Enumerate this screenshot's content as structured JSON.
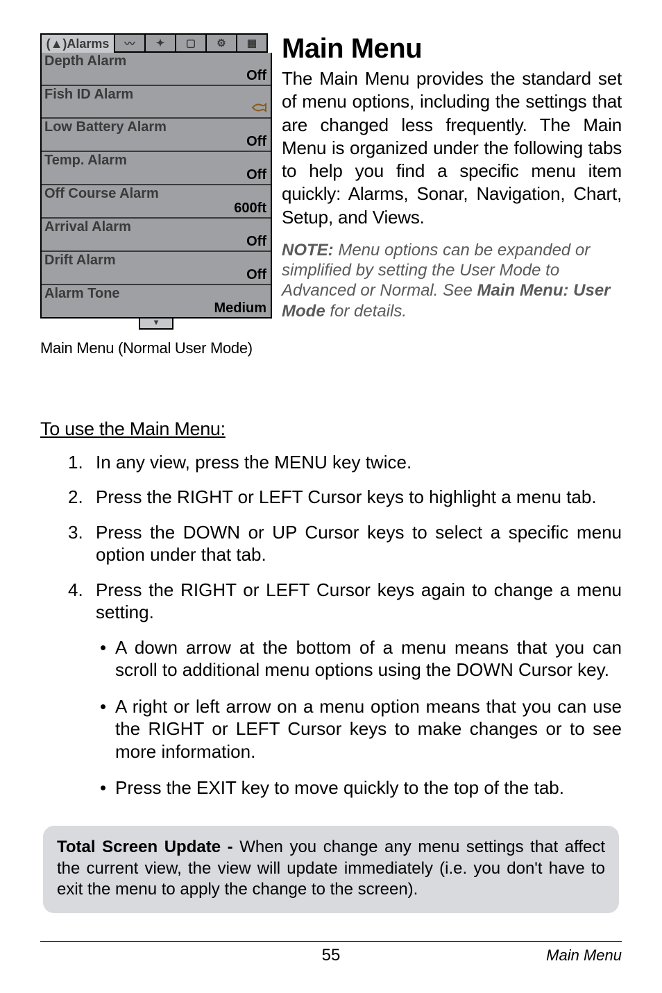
{
  "tabstrip": {
    "active_label": "(▲)Alarms"
  },
  "menu": {
    "rows": [
      {
        "label": "Depth Alarm",
        "value": "Off"
      },
      {
        "label": "Fish ID Alarm",
        "value": ""
      },
      {
        "label": "Low Battery Alarm",
        "value": "Off"
      },
      {
        "label": "Temp. Alarm",
        "value": "Off"
      },
      {
        "label": "Off Course Alarm",
        "value": "600ft"
      },
      {
        "label": "Arrival Alarm",
        "value": "Off"
      },
      {
        "label": "Drift Alarm",
        "value": "Off"
      },
      {
        "label": "Alarm Tone",
        "value": "Medium"
      }
    ],
    "caption": "Main Menu (Normal User Mode)"
  },
  "heading": "Main Menu",
  "intro": "The Main Menu provides the standard set of menu options, including the settings that are changed less frequently. The Main Menu is organized under the following tabs to help you find a specific menu item quickly: Alarms, Sonar, Navigation, Chart, Setup, and Views.",
  "note": {
    "label": "NOTE:",
    "body_a": " Menu options can be expanded or simplified by setting the User Mode to Advanced or Normal. See ",
    "um": "Main Menu: User Mode",
    "body_b": " for details."
  },
  "howto_title": "To use the Main Menu:",
  "steps": [
    "In any view, press the MENU key twice.",
    "Press the RIGHT or LEFT Cursor keys to highlight a menu tab.",
    "Press the DOWN or UP Cursor keys to select a specific menu option under that tab.",
    "Press the RIGHT or LEFT Cursor keys again to change a menu setting."
  ],
  "bullets": [
    "A down arrow at the bottom of a menu means that you can scroll to additional menu options using the DOWN Cursor key.",
    "A right or left arrow on a menu option means that you can use the RIGHT or LEFT Cursor keys to make changes or to see more information.",
    "Press the EXIT key to move quickly to the top of the tab."
  ],
  "callout": {
    "title": "Total Screen Update - ",
    "body": "When you change any menu settings that affect the current view, the view will update immediately (i.e. you don't have to exit the menu to apply the change to the screen)."
  },
  "footer": {
    "page": "55",
    "section": "Main Menu"
  }
}
